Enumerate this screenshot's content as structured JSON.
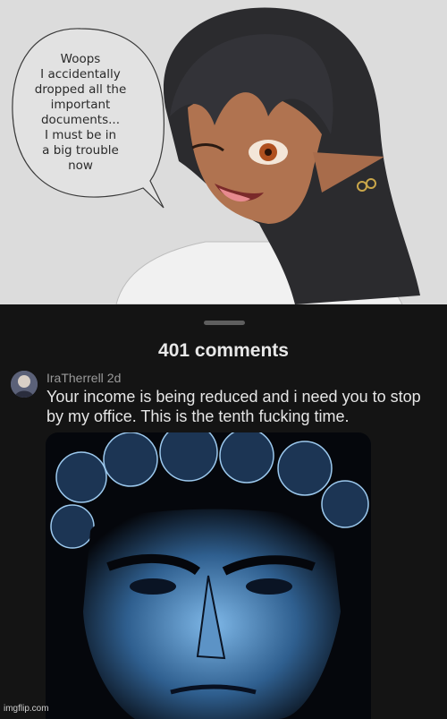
{
  "artwork": {
    "speech_bubble": "Woops\nI accidentally\ndropped all the\nimportant\ndocuments...\nI must be in\na big trouble\nnow"
  },
  "comments": {
    "count_label": "401 comments",
    "items": [
      {
        "username": "IraTherrell",
        "time": "2d",
        "text": "Your income is being reduced and i need you to stop by my office. This is the tenth fucking time."
      }
    ]
  },
  "watermark": "imgflip.com",
  "colors": {
    "sheet_bg": "#141414",
    "art_bg": "#dcdcdc",
    "text": "#e6e6e6",
    "muted": "#9a9a9a"
  }
}
